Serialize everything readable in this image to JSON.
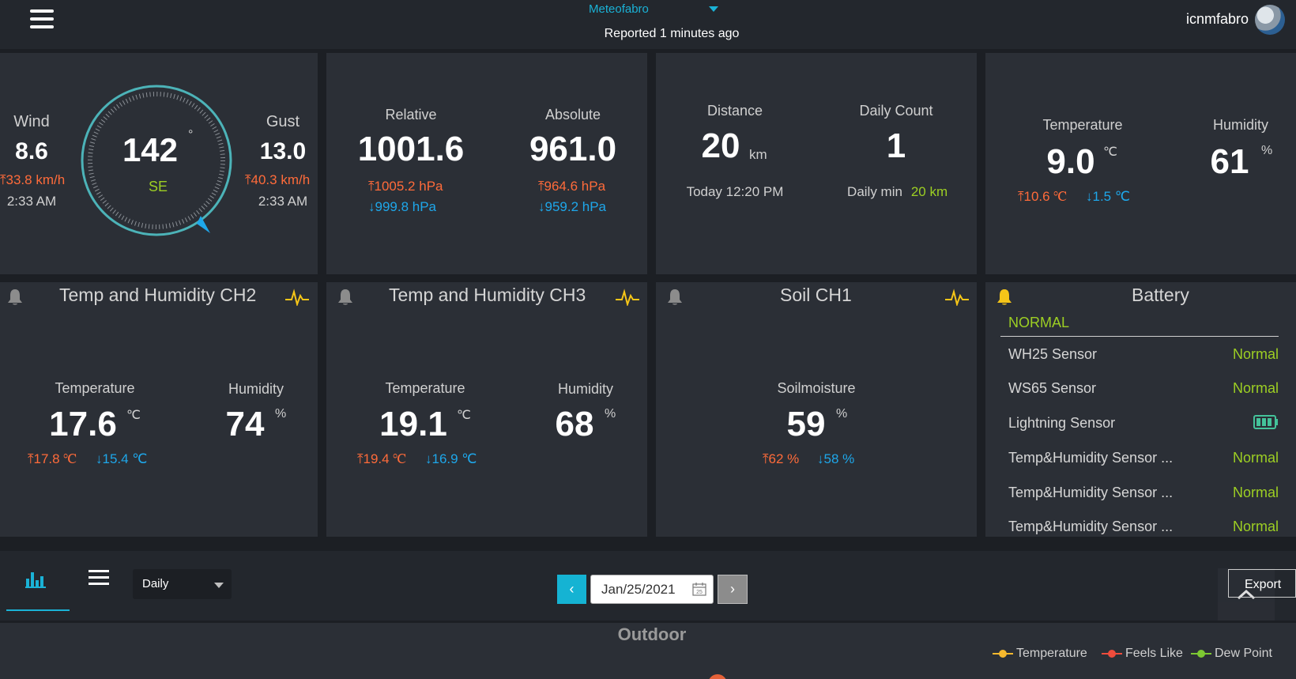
{
  "header": {
    "station": "Meteofabro",
    "reported": "Reported 1 minutes ago",
    "user": "icnmfabro"
  },
  "wind": {
    "wind_label": "Wind",
    "wind_value": "8.6",
    "wind_max": "33.8 km/h",
    "wind_time": "2:33 AM",
    "direction_deg": "142",
    "degree_symbol": "°",
    "direction_name": "SE",
    "gust_label": "Gust",
    "gust_value": "13.0",
    "gust_max": "40.3 km/h",
    "gust_time": "2:33 AM"
  },
  "pressure": {
    "relative_label": "Relative",
    "relative_value": "1001.6",
    "relative_max": "1005.2 hPa",
    "relative_min": "999.8 hPa",
    "absolute_label": "Absolute",
    "absolute_value": "961.0",
    "absolute_max": "964.6 hPa",
    "absolute_min": "959.2 hPa"
  },
  "lightning": {
    "distance_label": "Distance",
    "distance_value": "20",
    "distance_unit": "km",
    "distance_time": "Today 12:20 PM",
    "count_label": "Daily Count",
    "count_value": "1",
    "daily_min_label": "Daily min",
    "daily_min_value": "20 km"
  },
  "indoor": {
    "temp_label": "Temperature",
    "temp_value": "9.0",
    "temp_unit": "℃",
    "temp_max": "10.6 ℃",
    "temp_min": "1.5 ℃",
    "hum_label": "Humidity",
    "hum_value": "61",
    "hum_unit": "%"
  },
  "ch2": {
    "title": "Temp and Humidity CH2",
    "temp_label": "Temperature",
    "temp_value": "17.6",
    "temp_unit": "℃",
    "temp_max": "17.8 ℃",
    "temp_min": "15.4 ℃",
    "hum_label": "Humidity",
    "hum_value": "74",
    "hum_unit": "%"
  },
  "ch3": {
    "title": "Temp and Humidity CH3",
    "temp_label": "Temperature",
    "temp_value": "19.1",
    "temp_unit": "℃",
    "temp_max": "19.4 ℃",
    "temp_min": "16.9 ℃",
    "hum_label": "Humidity",
    "hum_value": "68",
    "hum_unit": "%"
  },
  "soil": {
    "title": "Soil CH1",
    "label": "Soilmoisture",
    "value": "59",
    "unit": "%",
    "max": "62 %",
    "min": "58 %"
  },
  "battery": {
    "title": "Battery",
    "status": "NORMAL",
    "rows": [
      {
        "name": "WH25 Sensor",
        "value": "Normal"
      },
      {
        "name": "WS65 Sensor",
        "value": "Normal"
      },
      {
        "name": "Lightning Sensor",
        "value": ""
      },
      {
        "name": "Temp&Humidity Sensor ...",
        "value": "Normal"
      },
      {
        "name": "Temp&Humidity Sensor ...",
        "value": "Normal"
      },
      {
        "name": "Temp&Humidity Sensor ...",
        "value": "Normal"
      }
    ]
  },
  "toolbar": {
    "period": "Daily",
    "date": "Jan/25/2021",
    "calendar_day": "25",
    "export": "Export"
  },
  "chart": {
    "title": "Outdoor",
    "legend": [
      {
        "name": "Temperature",
        "color": "#f5b82e"
      },
      {
        "name": "Feels Like",
        "color": "#ef4c3c"
      },
      {
        "name": "Dew Point",
        "color": "#7dc832"
      }
    ]
  },
  "colors": {
    "accent": "#1ab2d6",
    "high": "#ff6b3a",
    "low": "#1ea7ea",
    "ok_green": "#9dcf23",
    "alert_yellow": "#f5c518"
  }
}
